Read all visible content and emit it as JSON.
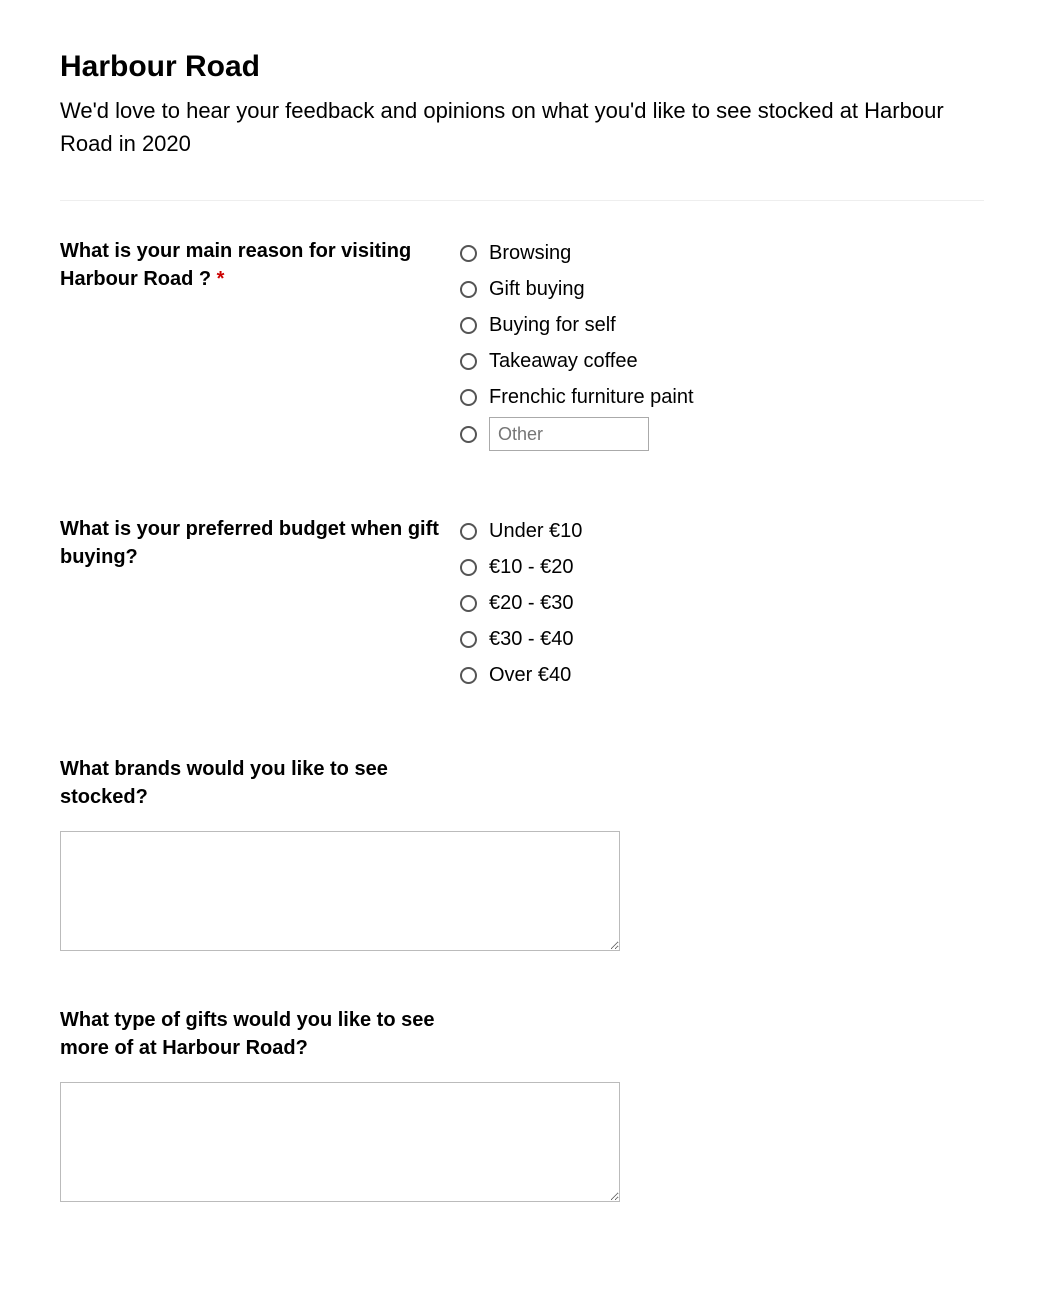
{
  "form": {
    "title": "Harbour Road",
    "description": "We'd love to hear your feedback and opinions on what you'd like to see stocked at Harbour Road in 2020"
  },
  "q1": {
    "label": "What is your main reason for visiting Harbour Road ? ",
    "required_marker": "*",
    "options": [
      "Browsing",
      "Gift buying",
      "Buying for self",
      "Takeaway coffee",
      "Frenchic furniture paint"
    ],
    "other_placeholder": "Other"
  },
  "q2": {
    "label": "What is your preferred budget when gift buying?",
    "options": [
      "Under €10",
      "€10 - €20",
      "€20 - €30",
      "€30 - €40",
      "Over €40"
    ]
  },
  "q3": {
    "label": "What brands would you like to see stocked?"
  },
  "q4": {
    "label": "What type of gifts would you like to see more of at Harbour Road?"
  }
}
